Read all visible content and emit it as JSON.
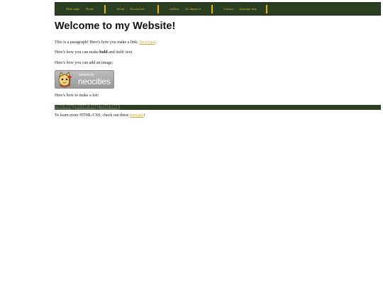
{
  "nav": {
    "groups": [
      {
        "label": "Main page",
        "sub": "Home"
      },
      {
        "label": "About",
        "sub": "In a nut'sea"
      },
      {
        "label": "Gallery",
        "sub": "Art dump-us"
      },
      {
        "label": "Contact",
        "sub": "whatsap? mai"
      }
    ]
  },
  "header": {
    "title": "Welcome to my Website!"
  },
  "content": {
    "p1_prefix": "This is a paragraph! Here's how you make a link: ",
    "p1_link": "Neocities",
    "p1_suffix": ".",
    "p2_prefix": "Here's how you can make ",
    "p2_bold": "bold",
    "p2_mid": " and ",
    "p2_italic": "italic",
    "p2_suffix": " text.",
    "p3": "Here's how you can add an image:",
    "badge_hosted": "hosted by",
    "badge_brand": "neocities",
    "p4": "Here's how to make a list:",
    "list": [
      "First thing",
      "Second thing",
      "Third thing"
    ],
    "p5_prefix": "To learn more HTML/CSS, check out these ",
    "p5_link": "tutorials",
    "p5_suffix": "!"
  },
  "colors": {
    "nav_bg": "#2b3f23",
    "nav_sep": "#e3b40f",
    "link": "#e0a72a"
  }
}
